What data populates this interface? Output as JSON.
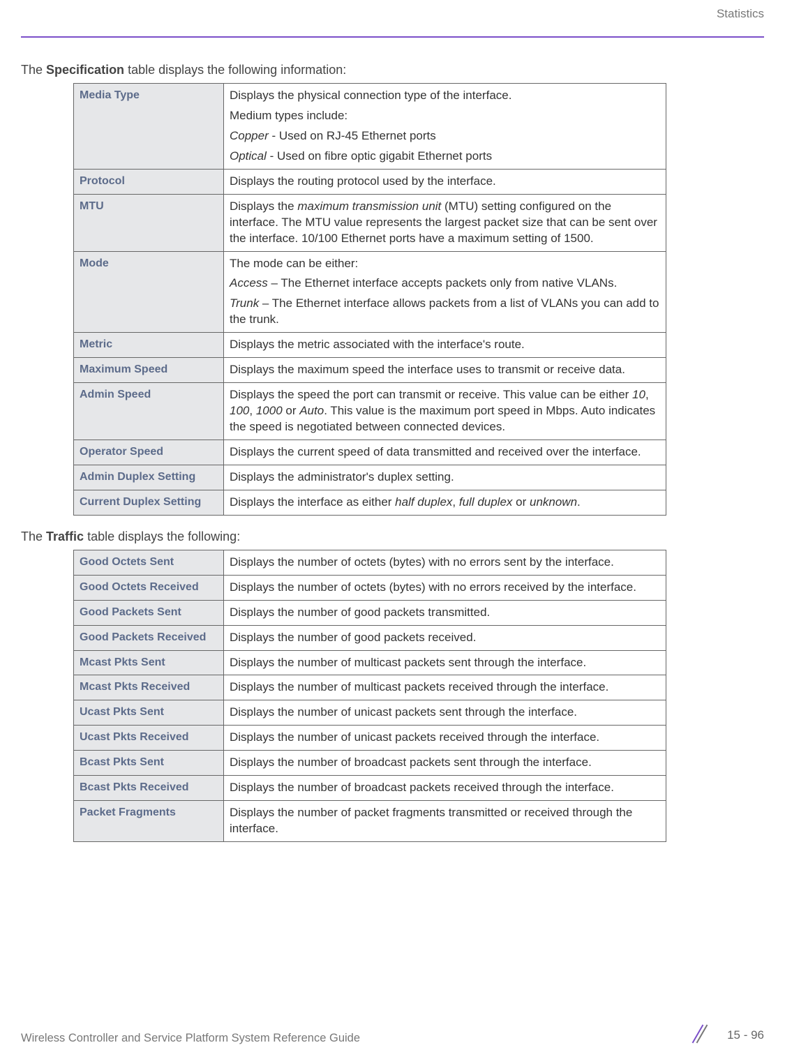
{
  "header": {
    "section": "Statistics"
  },
  "intro1_pre": "The ",
  "intro1_bold": "Specification",
  "intro1_post": " table displays the following information:",
  "spec": [
    {
      "label": "Media Type",
      "desc_html": "<p>Displays the physical connection type of the interface.</p><p>Medium types include:</p><p><i>Copper</i> - Used on RJ-45 Ethernet ports</p><p><i>Optical</i> - Used on fibre optic gigabit Ethernet ports</p>"
    },
    {
      "label": "Protocol",
      "desc_html": "Displays the routing protocol used by the interface."
    },
    {
      "label": "MTU",
      "desc_html": "Displays the <i>maximum transmission unit</i> (MTU) setting configured on the interface. The MTU value represents the largest packet size that can be sent over the interface. 10/100 Ethernet ports have a maximum setting of 1500."
    },
    {
      "label": "Mode",
      "desc_html": "<p>The mode can be either:</p><p><i>Access</i> – The Ethernet interface accepts packets only from native VLANs.</p><p><i>Trunk</i> – The Ethernet interface allows packets from a list of VLANs you can add to the trunk.</p>"
    },
    {
      "label": "Metric",
      "desc_html": "Displays the metric associated with the interface's route."
    },
    {
      "label": "Maximum Speed",
      "desc_html": "Displays the maximum speed the interface uses to transmit or receive data."
    },
    {
      "label": "Admin Speed",
      "desc_html": "Displays the speed the port can transmit or receive. This value can be either <i>10</i>, <i>100</i>, <i>1000</i> or <i>Auto</i>. This value is the maximum port speed in Mbps. Auto indicates the speed is negotiated between connected devices."
    },
    {
      "label": "Operator Speed",
      "desc_html": "Displays the current speed of data transmitted and received over the interface."
    },
    {
      "label": "Admin Duplex Setting",
      "desc_html": "Displays the administrator's duplex setting."
    },
    {
      "label": "Current Duplex Setting",
      "desc_html": "Displays the interface as either <i>half duplex</i>, <i>full duplex</i> or <i>unknown</i>."
    }
  ],
  "intro2_pre": "The ",
  "intro2_bold": "Traffic",
  "intro2_post": " table displays the following:",
  "traffic": [
    {
      "label": "Good Octets Sent",
      "desc_html": "Displays the number of octets (bytes) with no errors sent by the interface."
    },
    {
      "label": "Good Octets Received",
      "desc_html": "Displays the number of octets (bytes) with no errors received by the interface."
    },
    {
      "label": "Good Packets Sent",
      "desc_html": "Displays the number of good packets transmitted."
    },
    {
      "label": "Good Packets Received",
      "desc_html": "Displays the number of good packets received."
    },
    {
      "label": "Mcast Pkts Sent",
      "desc_html": "Displays the number of multicast packets sent through the interface."
    },
    {
      "label": "Mcast Pkts Received",
      "desc_html": "Displays the number of multicast packets received through the interface."
    },
    {
      "label": "Ucast Pkts Sent",
      "desc_html": "Displays the number of unicast packets sent through the interface."
    },
    {
      "label": "Ucast Pkts Received",
      "desc_html": "Displays the number of unicast packets received through the interface."
    },
    {
      "label": "Bcast Pkts Sent",
      "desc_html": "Displays the number of broadcast packets sent through the interface."
    },
    {
      "label": "Bcast Pkts Received",
      "desc_html": "Displays the number of broadcast packets received through the interface."
    },
    {
      "label": "Packet Fragments",
      "desc_html": "Displays the number of packet fragments transmitted or received through the interface."
    }
  ],
  "footer": {
    "guide": "Wireless Controller and Service Platform System Reference Guide",
    "page": "15 - 96"
  }
}
